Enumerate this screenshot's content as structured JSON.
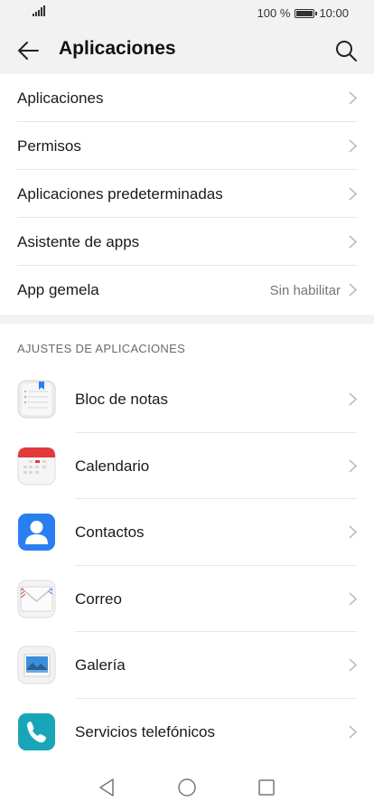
{
  "status_bar": {
    "battery_percent": "100 %",
    "time": "10:00"
  },
  "header": {
    "title": "Aplicaciones"
  },
  "menu": [
    {
      "label": "Aplicaciones",
      "value": ""
    },
    {
      "label": "Permisos",
      "value": ""
    },
    {
      "label": "Aplicaciones predeterminadas",
      "value": ""
    },
    {
      "label": "Asistente de apps",
      "value": ""
    },
    {
      "label": "App gemela",
      "value": "Sin habilitar"
    }
  ],
  "section": {
    "title": "AJUSTES DE APLICACIONES"
  },
  "apps": [
    {
      "label": "Bloc de notas",
      "icon": "notepad-icon"
    },
    {
      "label": "Calendario",
      "icon": "calendar-icon"
    },
    {
      "label": "Contactos",
      "icon": "contacts-icon"
    },
    {
      "label": "Correo",
      "icon": "mail-icon"
    },
    {
      "label": "Galería",
      "icon": "gallery-icon"
    },
    {
      "label": "Servicios telefónicos",
      "icon": "phone-icon"
    }
  ],
  "colors": {
    "header_bg": "#f2f2f2",
    "contacts_blue": "#2a7ff0",
    "phone_teal": "#17a6b8",
    "calendar_red": "#e23a3a"
  }
}
